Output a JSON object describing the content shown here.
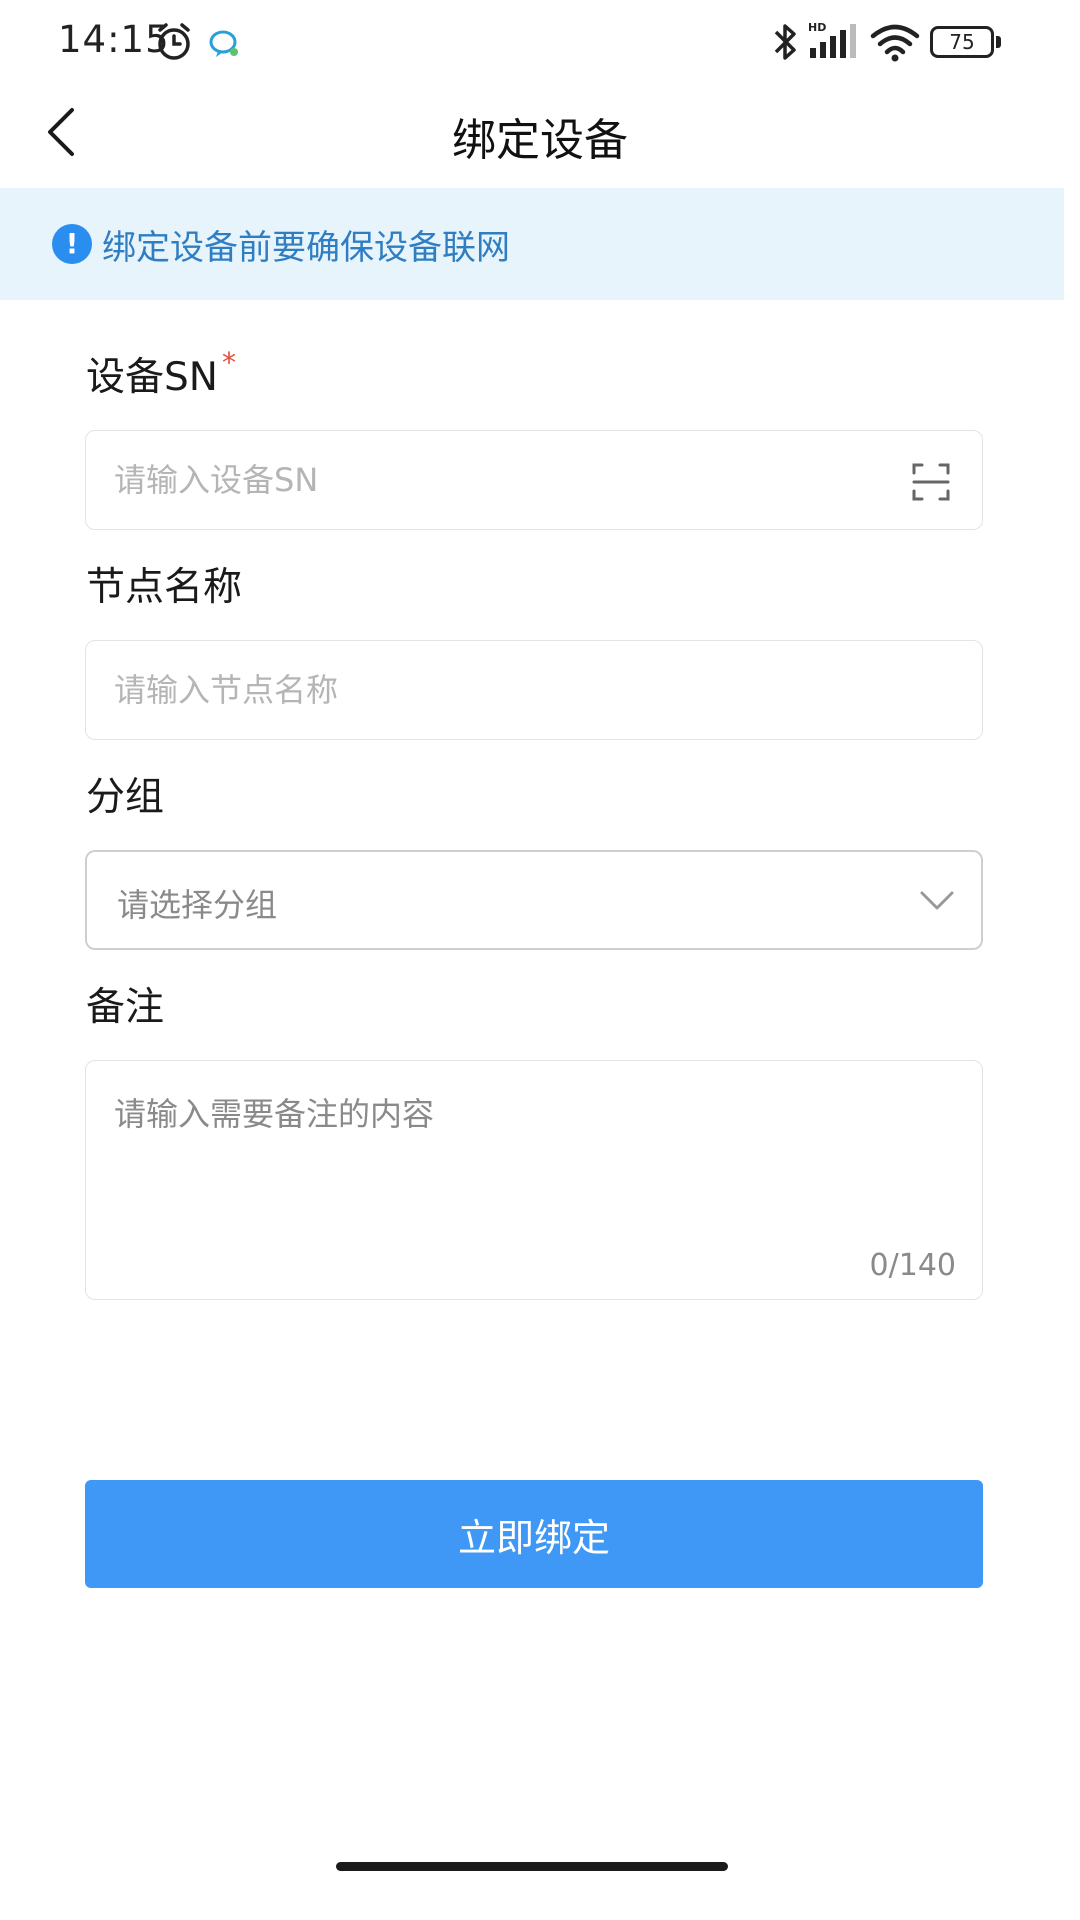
{
  "status_bar": {
    "time": "14:15",
    "battery": "75",
    "icons": [
      "alarm-icon",
      "chat-icon",
      "bluetooth-icon",
      "signal-icon",
      "wifi-icon",
      "battery-icon"
    ]
  },
  "header": {
    "title": "绑定设备",
    "back_icon": "chevron-left-icon"
  },
  "notice": {
    "text": "绑定设备前要确保设备联网",
    "icon_symbol": "!",
    "color": "#2f7ec2",
    "background": "#e8f4fc"
  },
  "form": {
    "device_sn": {
      "label": "设备SN",
      "required_mark": "*",
      "placeholder": "请输入设备SN",
      "value": ""
    },
    "node_name": {
      "label": "节点名称",
      "placeholder": "请输入节点名称",
      "value": ""
    },
    "group": {
      "label": "分组",
      "placeholder": "请选择分组"
    },
    "remark": {
      "label": "备注",
      "placeholder": "请输入需要备注的内容",
      "value": "",
      "counter": "0/140"
    }
  },
  "actions": {
    "bind_label": "立即绑定",
    "bind_color": "#3f98f5"
  }
}
